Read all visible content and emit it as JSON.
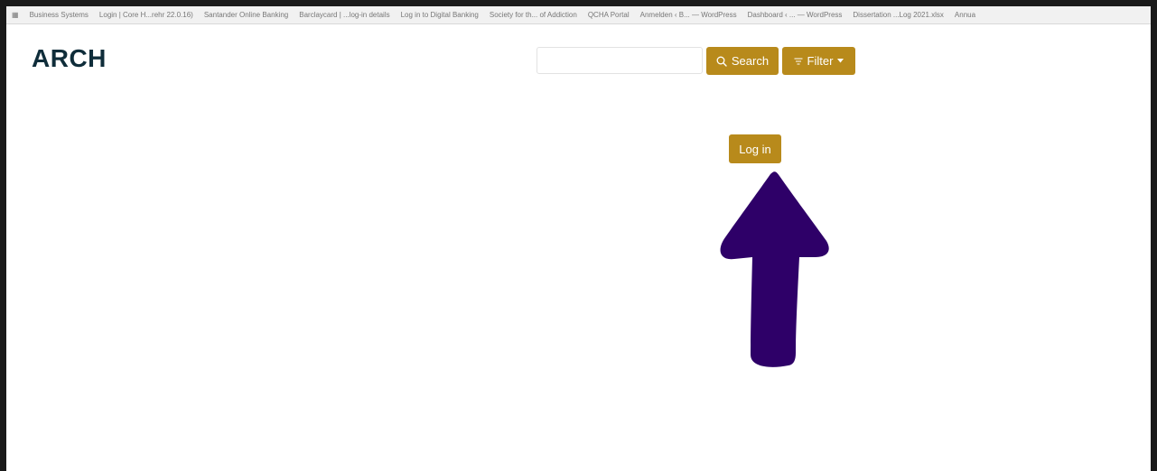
{
  "bookmarks": [
    "Business Systems",
    "Login | Core H...rehr 22.0.16)",
    "Santander Online Banking",
    "Barclaycard | ...log-in details",
    "Log in to Digital Banking",
    "Society for th... of Addiction",
    "QCHA Portal",
    "Anmelden ‹ B... — WordPress",
    "Dashboard ‹ ... — WordPress",
    "Dissertation ...Log 2021.xlsx",
    "Annua"
  ],
  "site": {
    "logo": "ARCH"
  },
  "search": {
    "placeholder": "",
    "value": "",
    "button_label": "Search"
  },
  "filter": {
    "button_label": "Filter"
  },
  "login": {
    "button_label": "Log in"
  },
  "colors": {
    "accent": "#b88a1b",
    "logo": "#0f2d3a",
    "arrow": "#2e0068"
  },
  "icons": {
    "search": "search-icon",
    "filter": "filter-icon",
    "caret": "caret-down-icon",
    "annotation": "arrow-up-icon"
  }
}
